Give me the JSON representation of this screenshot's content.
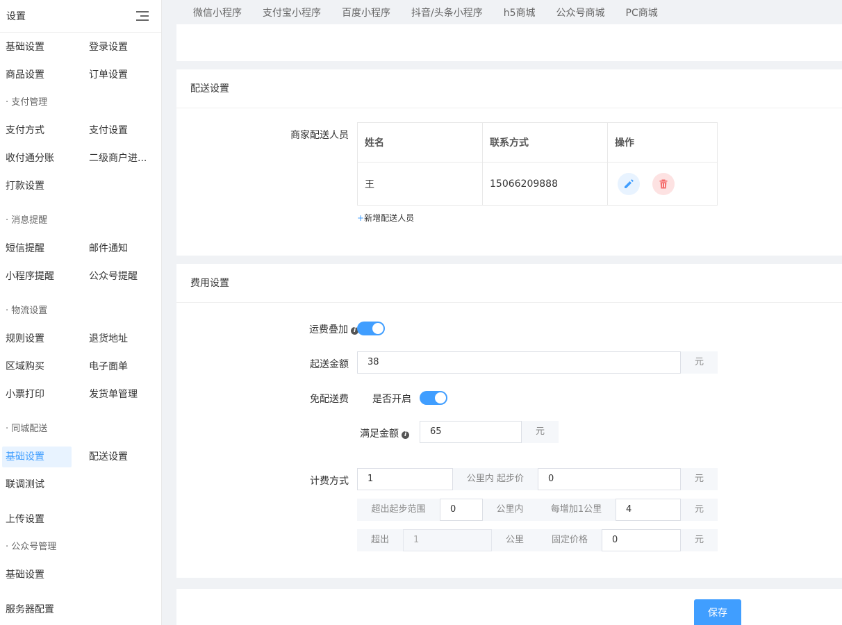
{
  "sidebar": {
    "title": "设置",
    "rows": [
      {
        "c1": "基础设置",
        "c2": "登录设置"
      },
      {
        "c1": "商品设置",
        "c2": "订单设置"
      },
      {
        "c1": "支付方式",
        "c2": "支付设置"
      },
      {
        "c1": "收付通分账",
        "c2": "二级商户进..."
      },
      {
        "c1": "打款设置"
      },
      {
        "c1": "短信提醒",
        "c2": "邮件通知"
      },
      {
        "c1": "小程序提醒",
        "c2": "公众号提醒"
      },
      {
        "c1": "规则设置",
        "c2": "退货地址"
      },
      {
        "c1": "区域购买",
        "c2": "电子面单"
      },
      {
        "c1": "小票打印",
        "c2": "发货单管理"
      },
      {
        "c1": "基础设置",
        "c2": "配送设置"
      },
      {
        "c1": "联调测试"
      },
      {
        "c1": "上传设置"
      },
      {
        "c1": "基础设置"
      },
      {
        "c1": "服务器配置"
      }
    ],
    "groups": [
      "· 支付管理",
      "· 消息提醒",
      "· 物流设置",
      "· 同城配送",
      "· 公众号管理"
    ]
  },
  "tabs": [
    "微信小程序",
    "支付宝小程序",
    "百度小程序",
    "抖音/头条小程序",
    "h5商城",
    "公众号商城",
    "PC商城"
  ],
  "delivery": {
    "title": "配送设置",
    "field_label": "商家配送人员",
    "columns": [
      "姓名",
      "联系方式",
      "操作"
    ],
    "rows": [
      {
        "name": "王",
        "phone": "15066209888"
      }
    ],
    "add_plus": "+",
    "add_label": "新增配送人员"
  },
  "fee": {
    "title": "费用设置",
    "stack_label": "运费叠加",
    "min_amount_label": "起送金额",
    "min_amount_value": "38",
    "unit_yuan": "元",
    "free_label": "免配送费",
    "free_enabled_label": "是否开启",
    "threshold_label": "满足金额",
    "threshold_value": "65",
    "billing_label": "计费方式",
    "km_value": "1",
    "km_base_label": "公里内 起步价",
    "base_price": "0",
    "beyond_range_label": "超出起步范围",
    "beyond_km": "0",
    "within_km_label": "公里内",
    "per_km_label": "每增加1公里",
    "per_km_price": "4",
    "exceed_label": "超出",
    "exceed_km_placeholder": "1",
    "km_label": "公里",
    "fixed_price_label": "固定价格",
    "fixed_price": "0"
  },
  "save_label": "保存",
  "colors": {
    "accent": "#409eff",
    "danger": "#f56c6c"
  }
}
